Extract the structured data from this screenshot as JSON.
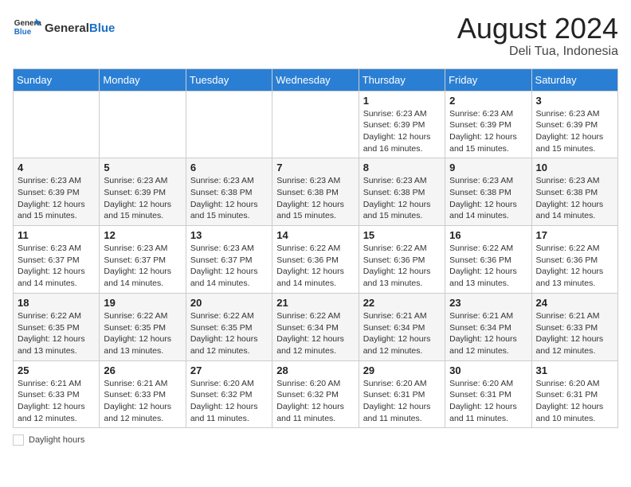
{
  "header": {
    "logo_general": "General",
    "logo_blue": "Blue",
    "month_year": "August 2024",
    "location": "Deli Tua, Indonesia"
  },
  "footer": {
    "label": "Daylight hours"
  },
  "weekdays": [
    "Sunday",
    "Monday",
    "Tuesday",
    "Wednesday",
    "Thursday",
    "Friday",
    "Saturday"
  ],
  "weeks": [
    [
      {
        "day": "",
        "info": ""
      },
      {
        "day": "",
        "info": ""
      },
      {
        "day": "",
        "info": ""
      },
      {
        "day": "",
        "info": ""
      },
      {
        "day": "1",
        "info": "Sunrise: 6:23 AM\nSunset: 6:39 PM\nDaylight: 12 hours\nand 16 minutes."
      },
      {
        "day": "2",
        "info": "Sunrise: 6:23 AM\nSunset: 6:39 PM\nDaylight: 12 hours\nand 15 minutes."
      },
      {
        "day": "3",
        "info": "Sunrise: 6:23 AM\nSunset: 6:39 PM\nDaylight: 12 hours\nand 15 minutes."
      }
    ],
    [
      {
        "day": "4",
        "info": "Sunrise: 6:23 AM\nSunset: 6:39 PM\nDaylight: 12 hours\nand 15 minutes."
      },
      {
        "day": "5",
        "info": "Sunrise: 6:23 AM\nSunset: 6:39 PM\nDaylight: 12 hours\nand 15 minutes."
      },
      {
        "day": "6",
        "info": "Sunrise: 6:23 AM\nSunset: 6:38 PM\nDaylight: 12 hours\nand 15 minutes."
      },
      {
        "day": "7",
        "info": "Sunrise: 6:23 AM\nSunset: 6:38 PM\nDaylight: 12 hours\nand 15 minutes."
      },
      {
        "day": "8",
        "info": "Sunrise: 6:23 AM\nSunset: 6:38 PM\nDaylight: 12 hours\nand 15 minutes."
      },
      {
        "day": "9",
        "info": "Sunrise: 6:23 AM\nSunset: 6:38 PM\nDaylight: 12 hours\nand 14 minutes."
      },
      {
        "day": "10",
        "info": "Sunrise: 6:23 AM\nSunset: 6:38 PM\nDaylight: 12 hours\nand 14 minutes."
      }
    ],
    [
      {
        "day": "11",
        "info": "Sunrise: 6:23 AM\nSunset: 6:37 PM\nDaylight: 12 hours\nand 14 minutes."
      },
      {
        "day": "12",
        "info": "Sunrise: 6:23 AM\nSunset: 6:37 PM\nDaylight: 12 hours\nand 14 minutes."
      },
      {
        "day": "13",
        "info": "Sunrise: 6:23 AM\nSunset: 6:37 PM\nDaylight: 12 hours\nand 14 minutes."
      },
      {
        "day": "14",
        "info": "Sunrise: 6:22 AM\nSunset: 6:36 PM\nDaylight: 12 hours\nand 14 minutes."
      },
      {
        "day": "15",
        "info": "Sunrise: 6:22 AM\nSunset: 6:36 PM\nDaylight: 12 hours\nand 13 minutes."
      },
      {
        "day": "16",
        "info": "Sunrise: 6:22 AM\nSunset: 6:36 PM\nDaylight: 12 hours\nand 13 minutes."
      },
      {
        "day": "17",
        "info": "Sunrise: 6:22 AM\nSunset: 6:36 PM\nDaylight: 12 hours\nand 13 minutes."
      }
    ],
    [
      {
        "day": "18",
        "info": "Sunrise: 6:22 AM\nSunset: 6:35 PM\nDaylight: 12 hours\nand 13 minutes."
      },
      {
        "day": "19",
        "info": "Sunrise: 6:22 AM\nSunset: 6:35 PM\nDaylight: 12 hours\nand 13 minutes."
      },
      {
        "day": "20",
        "info": "Sunrise: 6:22 AM\nSunset: 6:35 PM\nDaylight: 12 hours\nand 12 minutes."
      },
      {
        "day": "21",
        "info": "Sunrise: 6:22 AM\nSunset: 6:34 PM\nDaylight: 12 hours\nand 12 minutes."
      },
      {
        "day": "22",
        "info": "Sunrise: 6:21 AM\nSunset: 6:34 PM\nDaylight: 12 hours\nand 12 minutes."
      },
      {
        "day": "23",
        "info": "Sunrise: 6:21 AM\nSunset: 6:34 PM\nDaylight: 12 hours\nand 12 minutes."
      },
      {
        "day": "24",
        "info": "Sunrise: 6:21 AM\nSunset: 6:33 PM\nDaylight: 12 hours\nand 12 minutes."
      }
    ],
    [
      {
        "day": "25",
        "info": "Sunrise: 6:21 AM\nSunset: 6:33 PM\nDaylight: 12 hours\nand 12 minutes."
      },
      {
        "day": "26",
        "info": "Sunrise: 6:21 AM\nSunset: 6:33 PM\nDaylight: 12 hours\nand 12 minutes."
      },
      {
        "day": "27",
        "info": "Sunrise: 6:20 AM\nSunset: 6:32 PM\nDaylight: 12 hours\nand 11 minutes."
      },
      {
        "day": "28",
        "info": "Sunrise: 6:20 AM\nSunset: 6:32 PM\nDaylight: 12 hours\nand 11 minutes."
      },
      {
        "day": "29",
        "info": "Sunrise: 6:20 AM\nSunset: 6:31 PM\nDaylight: 12 hours\nand 11 minutes."
      },
      {
        "day": "30",
        "info": "Sunrise: 6:20 AM\nSunset: 6:31 PM\nDaylight: 12 hours\nand 11 minutes."
      },
      {
        "day": "31",
        "info": "Sunrise: 6:20 AM\nSunset: 6:31 PM\nDaylight: 12 hours\nand 10 minutes."
      }
    ]
  ]
}
